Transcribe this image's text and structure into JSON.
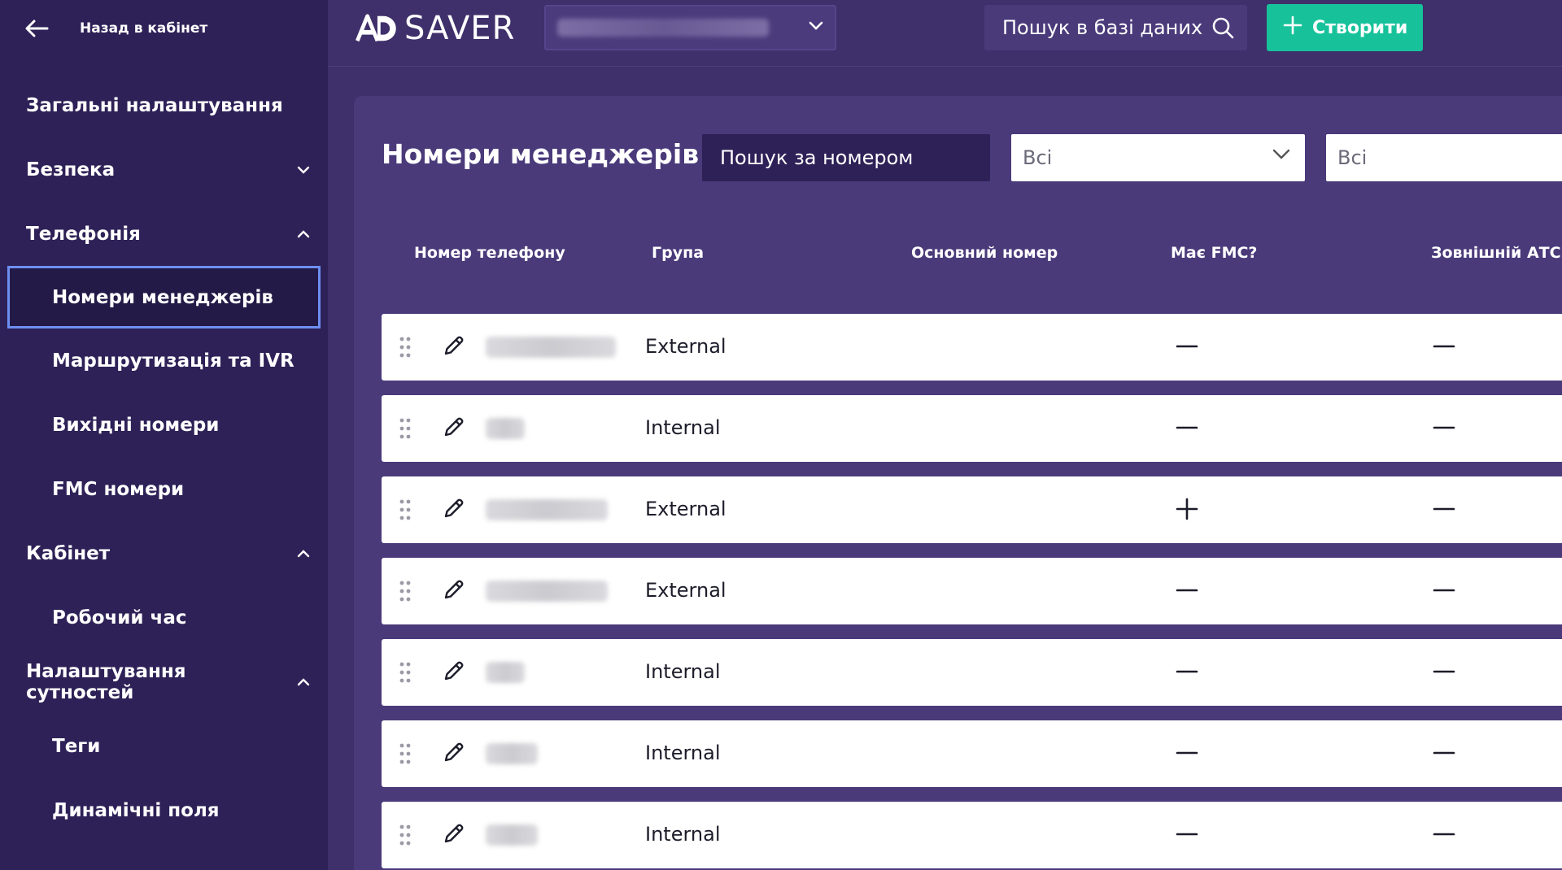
{
  "sidebar": {
    "back_label": "Назад в кабінет",
    "items": [
      {
        "label": "Загальні налаштування",
        "type": "top",
        "chevron": ""
      },
      {
        "label": "Безпека",
        "type": "top",
        "chevron": "down"
      },
      {
        "label": "Телефонія",
        "type": "top",
        "chevron": "up"
      },
      {
        "label": "Номери менеджерів",
        "type": "sub",
        "active": true
      },
      {
        "label": "Маршрутизація та IVR",
        "type": "sub"
      },
      {
        "label": "Вихідні номери",
        "type": "sub"
      },
      {
        "label": "FMC номери",
        "type": "sub"
      },
      {
        "label": "Кабінет",
        "type": "top",
        "chevron": "up"
      },
      {
        "label": "Робочий час",
        "type": "sub"
      },
      {
        "label": "Налаштування сутностей",
        "type": "top",
        "chevron": "up"
      },
      {
        "label": "Теги",
        "type": "sub"
      },
      {
        "label": "Динамічні поля",
        "type": "sub"
      }
    ]
  },
  "topbar": {
    "logo_mark": "AD",
    "logo_text": "SAVER",
    "search_label": "Пошук в базі даних",
    "create_label": "Створити"
  },
  "main": {
    "title": "Номери менеджерів",
    "number_search_placeholder": "Пошук за номером",
    "filter_1_value": "Всі",
    "filter_2_value": "Всі",
    "columns": {
      "phone": "Номер телефону",
      "group": "Група",
      "main_number": "Основний номер",
      "has_fmc": "Має FMC?",
      "external_pbx": "Зовнішній АТС"
    },
    "rows": [
      {
        "group": "External",
        "has_fmc": "no",
        "external_pbx": "no"
      },
      {
        "group": "Internal",
        "has_fmc": "no",
        "external_pbx": "no"
      },
      {
        "group": "External",
        "has_fmc": "yes",
        "external_pbx": "no"
      },
      {
        "group": "External",
        "has_fmc": "no",
        "external_pbx": "no"
      },
      {
        "group": "Internal",
        "has_fmc": "no",
        "external_pbx": "no"
      },
      {
        "group": "Internal",
        "has_fmc": "no",
        "external_pbx": "no"
      },
      {
        "group": "Internal",
        "has_fmc": "no",
        "external_pbx": "no"
      }
    ]
  },
  "colors": {
    "sidebar_bg": "#2e2157",
    "page_bg": "#3f2f6a",
    "panel_bg": "#4a3a7a",
    "accent_green": "#17c29b",
    "active_border": "#6d8ff2"
  }
}
